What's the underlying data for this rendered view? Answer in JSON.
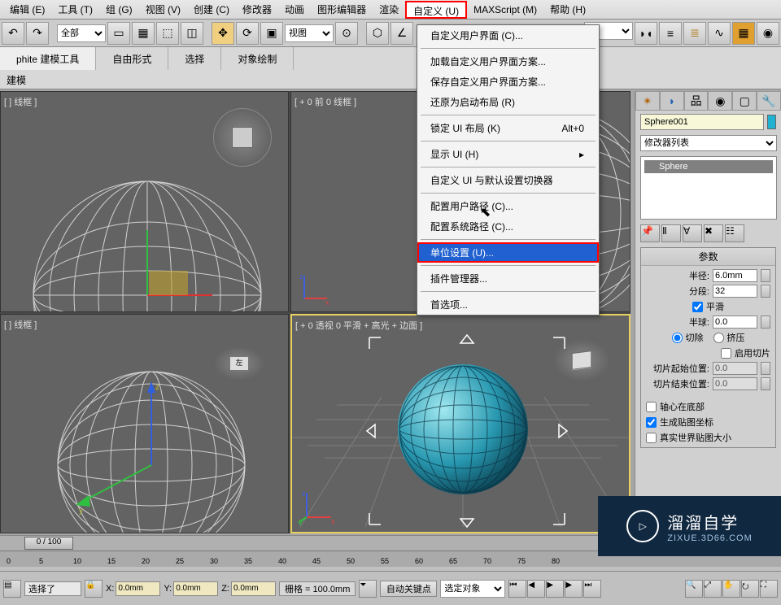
{
  "menubar": [
    "编辑 (E)",
    "工具 (T)",
    "组 (G)",
    "视图 (V)",
    "创建 (C)",
    "修改器",
    "动画",
    "图形编辑器",
    "渲染",
    "自定义 (U)",
    "MAXScript (M)",
    "帮助 (H)"
  ],
  "menubar_active_index": 9,
  "toolbar": {
    "selection_filter": "全部",
    "ref_coord": "视图"
  },
  "ribbon": {
    "tabs": [
      "phite 建模工具",
      "自由形式",
      "选择",
      "对象绘制"
    ],
    "sub": "建模"
  },
  "viewports": {
    "v0": "[ ] 线框 ]",
    "v1": "[ + 0 前 0 线框 ]",
    "v2": "[ ] 线框 ]",
    "v3": "[ + 0 透视 0 平滑 + 高光 + 边面 ]"
  },
  "dropdown": {
    "items": [
      {
        "label": "自定义用户界面 (C)...",
        "type": "item"
      },
      {
        "type": "sep"
      },
      {
        "label": "加载自定义用户界面方案...",
        "type": "item"
      },
      {
        "label": "保存自定义用户界面方案...",
        "type": "item"
      },
      {
        "label": "还原为启动布局 (R)",
        "type": "item"
      },
      {
        "type": "sep"
      },
      {
        "label": "锁定 UI 布局 (K)",
        "shortcut": "Alt+0",
        "type": "item"
      },
      {
        "type": "sep"
      },
      {
        "label": "显示 UI (H)",
        "sub": true,
        "type": "item"
      },
      {
        "type": "sep"
      },
      {
        "label": "自定义 UI 与默认设置切换器",
        "type": "item"
      },
      {
        "type": "sep"
      },
      {
        "label": "配置用户路径 (C)...",
        "type": "item"
      },
      {
        "label": "配置系统路径 (C)...",
        "type": "item"
      },
      {
        "type": "sep"
      },
      {
        "label": "单位设置 (U)...",
        "type": "item",
        "hi": true,
        "box": true
      },
      {
        "type": "sep"
      },
      {
        "label": "插件管理器...",
        "type": "item"
      },
      {
        "type": "sep"
      },
      {
        "label": "首选项...",
        "type": "item"
      }
    ]
  },
  "side": {
    "obj_name": "Sphere001",
    "mod_label": "修改器列表",
    "stack_item": "Sphere",
    "rollout_title": "参数",
    "radius_label": "半径:",
    "radius_value": "6.0mm",
    "segs_label": "分段:",
    "segs_value": "32",
    "smooth": "平滑",
    "hemi_label": "半球:",
    "hemi_value": "0.0",
    "radio_chop": "切除",
    "radio_squash": "挤压",
    "slice_on": "启用切片",
    "slice_from_label": "切片起始位置:",
    "slice_from_value": "0.0",
    "slice_to_label": "切片结束位置:",
    "slice_to_value": "0.0",
    "base_pivot": "轴心在底部",
    "gen_uv": "生成贴图坐标",
    "real_world": "真实世界贴图大小"
  },
  "timeline": {
    "slider": "0 / 100",
    "ticks": [
      "0",
      "5",
      "10",
      "15",
      "20",
      "25",
      "30",
      "35",
      "40",
      "45",
      "50",
      "55",
      "60",
      "65",
      "70",
      "75",
      "80"
    ]
  },
  "status": {
    "selected": "选择了",
    "x_label": "X:",
    "x": "0.0mm",
    "y_label": "Y:",
    "y": "0.0mm",
    "z_label": "Z:",
    "z": "0.0mm",
    "grid_label": "栅格 = 100.0mm",
    "autokey": "自动关键点",
    "key_filter": "选定对象"
  },
  "watermark": {
    "brand": "溜溜自学",
    "url": "ZIXUE.3D66.COM"
  }
}
